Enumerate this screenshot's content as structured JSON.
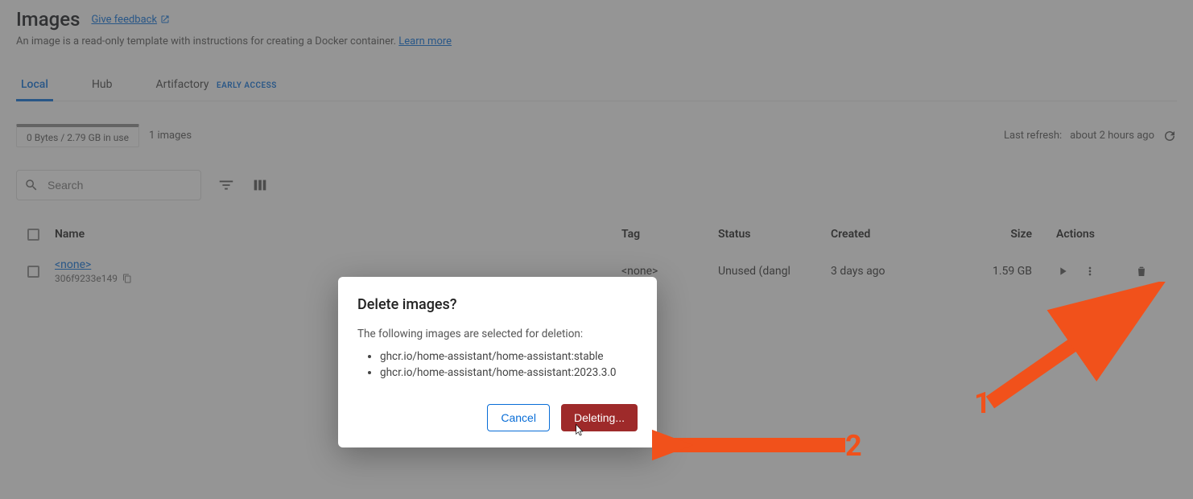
{
  "header": {
    "title": "Images",
    "feedback_link": "Give feedback",
    "description": "An image is a read-only template with instructions for creating a Docker container.",
    "learn_more": "Learn more"
  },
  "tabs": {
    "local": "Local",
    "hub": "Hub",
    "artifactory": "Artifactory",
    "artifactory_badge": "EARLY ACCESS"
  },
  "usage": {
    "text": "0 Bytes / 2.79 GB in use",
    "count": "1 images"
  },
  "refresh": {
    "prefix": "Last refresh:",
    "value": "about 2 hours ago"
  },
  "search": {
    "placeholder": "Search"
  },
  "columns": {
    "name": "Name",
    "tag": "Tag",
    "status": "Status",
    "created": "Created",
    "size": "Size",
    "actions": "Actions"
  },
  "rows": [
    {
      "name": "<none>",
      "hash": "306f9233e149",
      "tag": "<none>",
      "status": "Unused (dangl",
      "created": "3 days ago",
      "size": "1.59 GB"
    }
  ],
  "dialog": {
    "title": "Delete images?",
    "subtitle": "The following images are selected for deletion:",
    "items": [
      "ghcr.io/home-assistant/home-assistant:stable",
      "ghcr.io/home-assistant/home-assistant:2023.3.0"
    ],
    "cancel": "Cancel",
    "confirm": "Deleting..."
  },
  "annotations": {
    "one": "1",
    "two": "2"
  }
}
